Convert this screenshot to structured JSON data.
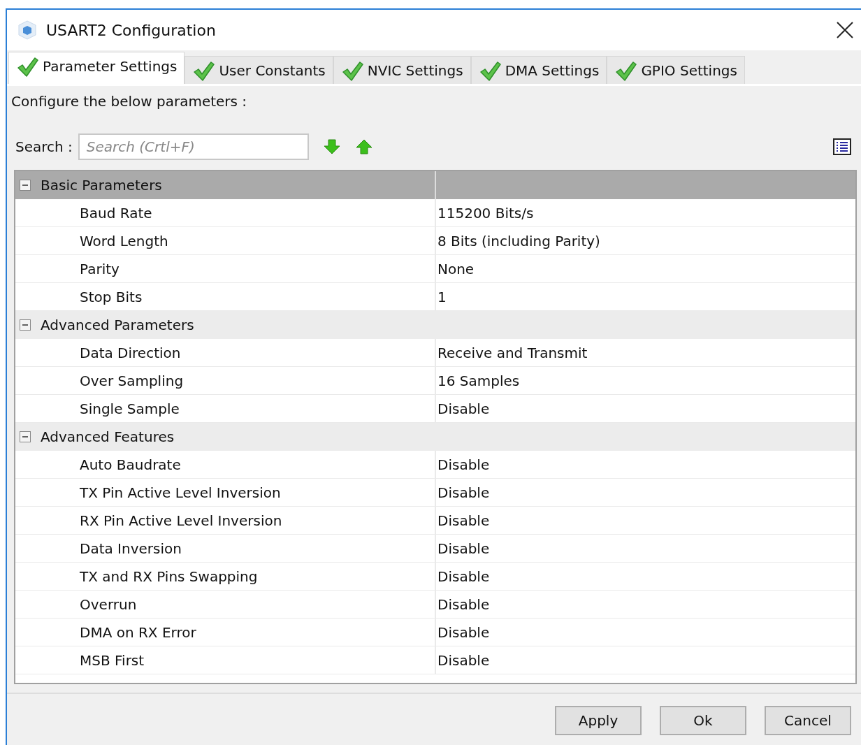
{
  "window": {
    "title": "USART2 Configuration"
  },
  "tabs": [
    {
      "label": "Parameter Settings",
      "selected": true
    },
    {
      "label": "User Constants",
      "selected": false
    },
    {
      "label": "NVIC Settings",
      "selected": false
    },
    {
      "label": "DMA Settings",
      "selected": false
    },
    {
      "label": "GPIO Settings",
      "selected": false
    }
  ],
  "instructions": "Configure the below parameters :",
  "search": {
    "label": "Search :",
    "placeholder": "Search (Crtl+F)"
  },
  "groups": [
    {
      "name": "Basic Parameters",
      "expanded": true,
      "selected": true,
      "rows": [
        {
          "name": "Baud Rate",
          "value": "115200 Bits/s"
        },
        {
          "name": "Word Length",
          "value": "8 Bits (including Parity)"
        },
        {
          "name": "Parity",
          "value": "None"
        },
        {
          "name": "Stop Bits",
          "value": "1"
        }
      ]
    },
    {
      "name": "Advanced Parameters",
      "expanded": true,
      "selected": false,
      "rows": [
        {
          "name": "Data Direction",
          "value": "Receive and Transmit"
        },
        {
          "name": "Over Sampling",
          "value": "16 Samples"
        },
        {
          "name": "Single Sample",
          "value": "Disable"
        }
      ]
    },
    {
      "name": "Advanced Features",
      "expanded": true,
      "selected": false,
      "rows": [
        {
          "name": "Auto Baudrate",
          "value": "Disable"
        },
        {
          "name": "TX Pin Active Level Inversion",
          "value": "Disable"
        },
        {
          "name": "RX Pin Active Level Inversion",
          "value": "Disable"
        },
        {
          "name": "Data Inversion",
          "value": "Disable"
        },
        {
          "name": "TX and RX Pins Swapping",
          "value": "Disable"
        },
        {
          "name": "Overrun",
          "value": "Disable"
        },
        {
          "name": "DMA on RX Error",
          "value": "Disable"
        },
        {
          "name": "MSB First",
          "value": "Disable"
        }
      ]
    }
  ],
  "buttons": [
    "Apply",
    "Ok",
    "Cancel"
  ]
}
